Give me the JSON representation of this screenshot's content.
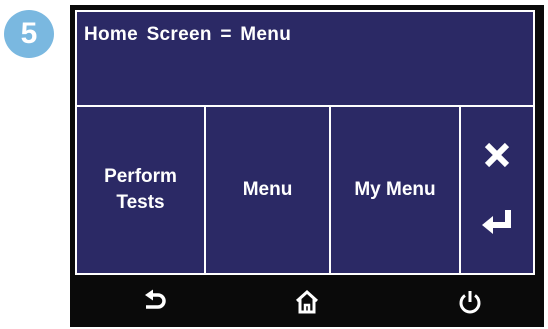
{
  "step_badge": "5",
  "screen": {
    "title": "Home  Screen  =  Menu"
  },
  "buttons": [
    {
      "label_line1": "Perform",
      "label_line2": "Tests"
    },
    {
      "label": "Menu"
    },
    {
      "label": "My Menu"
    }
  ],
  "side_icons": [
    "close-icon",
    "enter-icon"
  ],
  "nav_icons": [
    "back-icon",
    "home-icon",
    "power-icon"
  ],
  "colors": {
    "screen_background": "#2b2965",
    "badge": "#7ab8e0",
    "device_bezel": "#0a0a0a",
    "text": "#ffffff"
  }
}
